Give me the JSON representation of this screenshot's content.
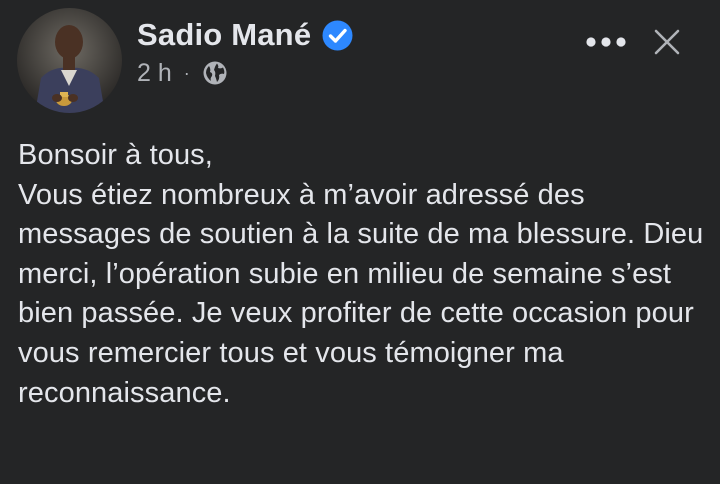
{
  "author": {
    "name": "Sadio Mané",
    "verified": true,
    "avatar_icon": "profile-photo"
  },
  "meta": {
    "time": "2 h",
    "separator": "·",
    "audience_icon": "globe-icon"
  },
  "actions": {
    "more_icon": "more-options-icon",
    "close_icon": "close-icon"
  },
  "post": {
    "text": "Bonsoir à tous,\nVous étiez nombreux à m’avoir adressé des messages de soutien à la suite de ma blessure. Dieu merci, l’opération subie en milieu de semaine s’est bien passée. Je veux profiter de cette occasion pour vous remercier tous et vous témoigner ma reconnaissance."
  },
  "colors": {
    "background": "#242526",
    "primary_text": "#e4e6eb",
    "secondary_text": "#b0b3b8",
    "verified_badge": "#2d88ff"
  }
}
